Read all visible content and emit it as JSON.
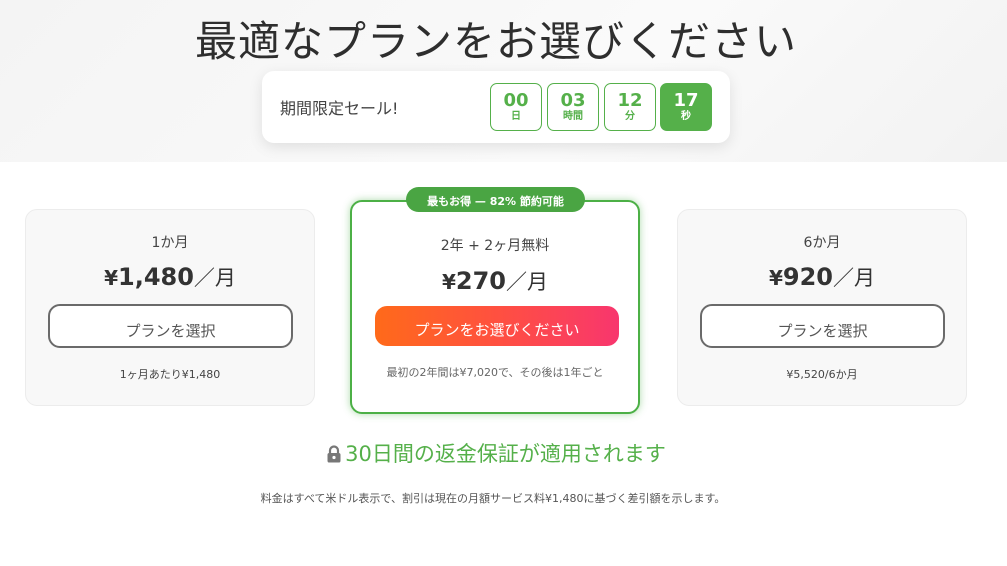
{
  "headline": "最適なプランをお選びください",
  "sale": {
    "label": "期間限定セール!",
    "countdown": [
      {
        "value": "00",
        "unit": "日",
        "active": false
      },
      {
        "value": "03",
        "unit": "時間",
        "active": false
      },
      {
        "value": "12",
        "unit": "分",
        "active": false
      },
      {
        "value": "17",
        "unit": "秒",
        "active": true
      }
    ]
  },
  "plans": {
    "monthly": {
      "name": "1か月",
      "currency": "¥",
      "price": "1,480",
      "per": "／月",
      "button": "プランを選択",
      "note": "1ヶ月あたり¥1,480"
    },
    "featured": {
      "badge": "最もお得 — 82% 節約可能",
      "name": "2年 + 2ヶ月無料",
      "currency": "¥",
      "price": "270",
      "per": "／月",
      "button": "プランをお選びください",
      "note": "最初の2年間は¥7,020で、その後は1年ごと"
    },
    "six_month": {
      "name": "6か月",
      "currency": "¥",
      "price": "920",
      "per": "／月",
      "button": "プランを選択",
      "note": "¥5,520/6か月"
    }
  },
  "guarantee": "30日間の返金保証が適用されます",
  "footnote": "料金はすべて米ドル表示で、割引は現在の月額サービス料¥1,480に基づく差引額を示します。",
  "colors": {
    "accent_green": "#55b04a",
    "cta_gradient_start": "#ff6a1a",
    "cta_gradient_end": "#f8366e"
  },
  "icons": {
    "guarantee": "lock-icon"
  }
}
